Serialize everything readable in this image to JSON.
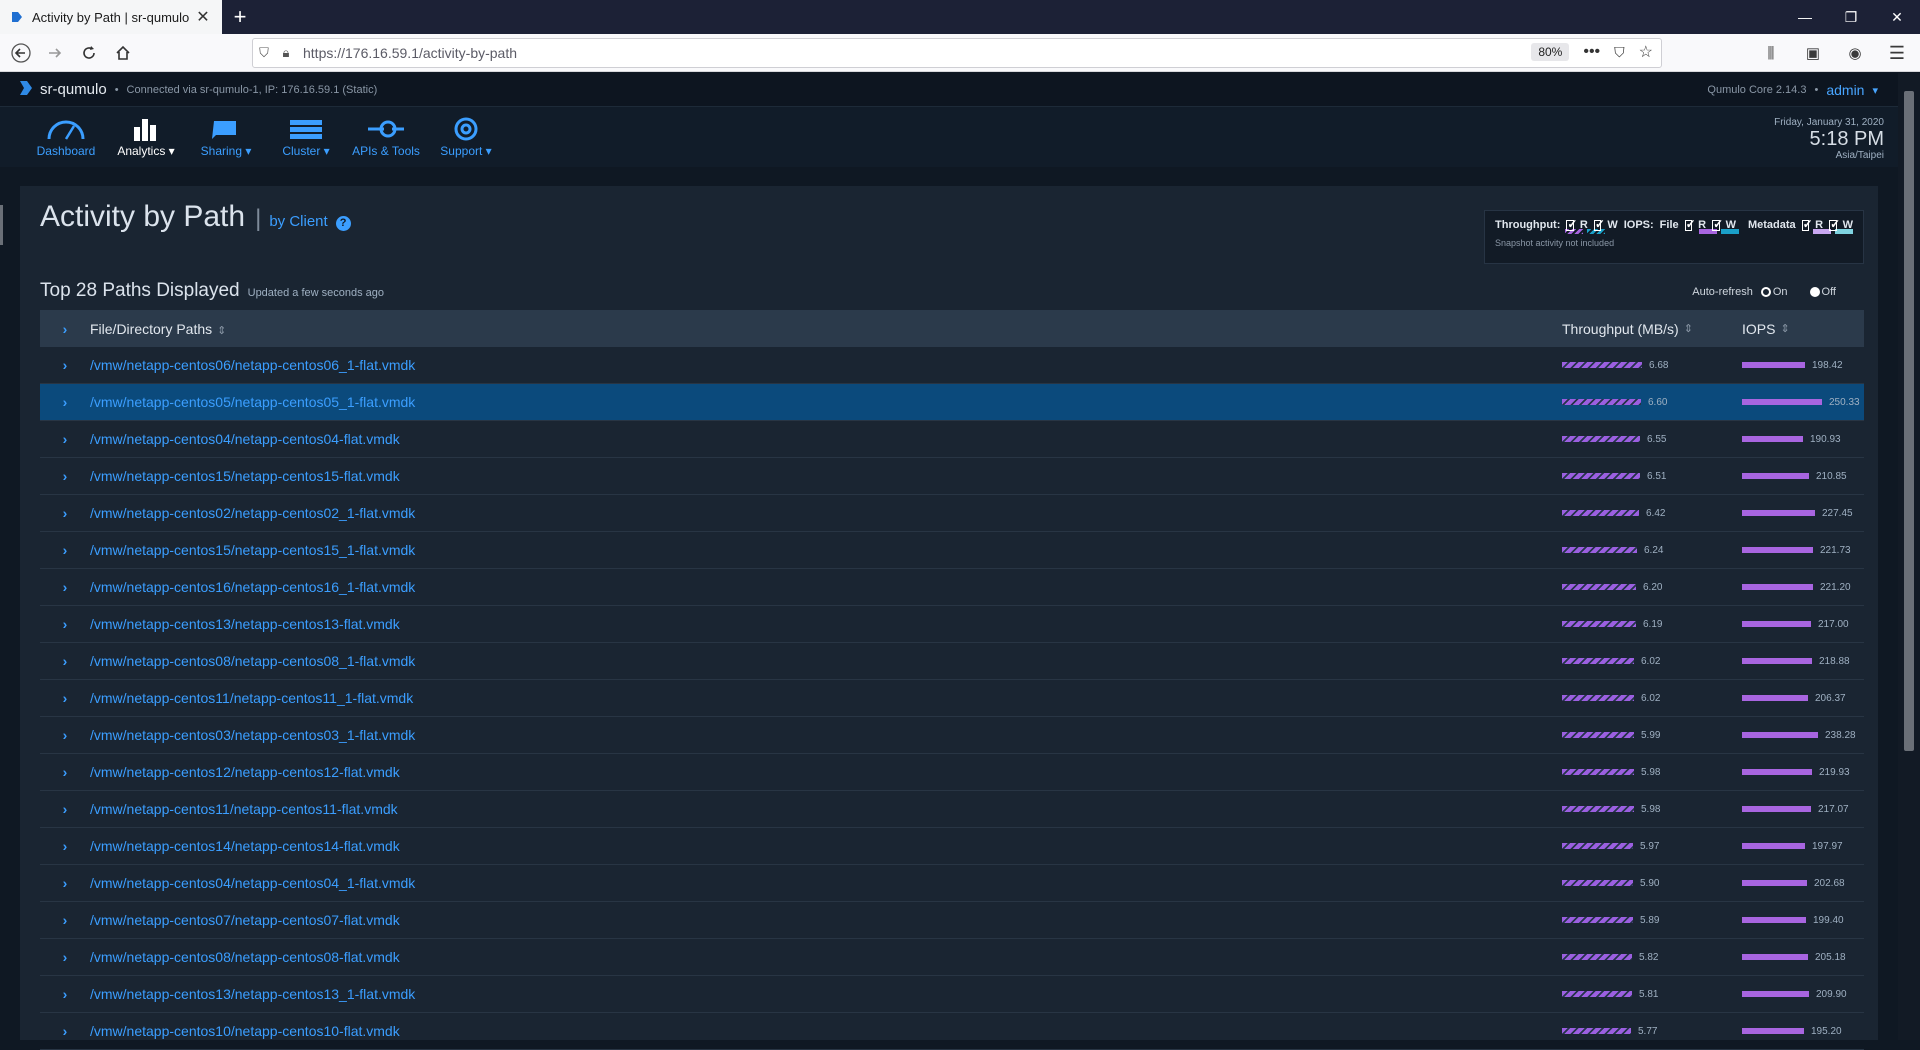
{
  "browser": {
    "tab_title": "Activity by Path | sr-qumulo",
    "url": "https://176.16.59.1/activity-by-path",
    "zoom": "80%"
  },
  "app": {
    "brand": "sr-qumulo",
    "connection": "Connected via sr-qumulo-1, IP: 176.16.59.1 (Static)",
    "version": "Qumulo Core 2.14.3",
    "user": "admin"
  },
  "nav": {
    "items": [
      {
        "label": "Dashboard",
        "icon": "dashboard-icon"
      },
      {
        "label": "Analytics ▾",
        "icon": "analytics-icon"
      },
      {
        "label": "Sharing ▾",
        "icon": "sharing-icon"
      },
      {
        "label": "Cluster ▾",
        "icon": "cluster-icon"
      },
      {
        "label": "APIs & Tools",
        "icon": "apis-icon"
      },
      {
        "label": "Support ▾",
        "icon": "support-icon"
      }
    ]
  },
  "clock": {
    "date": "Friday, January 31, 2020",
    "time": "5:18 PM",
    "tz": "Asia/Taipei"
  },
  "page": {
    "title": "Activity by Path",
    "by_client": "by Client",
    "subtitle": "Top 28 Paths Displayed",
    "updated": "Updated a few seconds ago",
    "auto_refresh": "Auto-refresh",
    "on": "On",
    "off": "Off"
  },
  "legend": {
    "throughput": "Throughput:",
    "iops": "IOPS:",
    "file": "File",
    "metadata": "Metadata",
    "r": "R",
    "w": "W",
    "note": "Snapshot activity not included",
    "colors": {
      "read": "#a865e0",
      "write": "#1aa0c8",
      "meta_read": "#c9a7f0",
      "meta_write": "#7fd3e0"
    }
  },
  "table": {
    "headers": {
      "path": "File/Directory Paths",
      "throughput": "Throughput (MB/s)",
      "iops": "IOPS"
    },
    "max_throughput": 6.68,
    "max_iops": 250.33,
    "rows": [
      {
        "path": "/vmw/netapp-centos06/netapp-centos06_1-flat.vmdk",
        "tp": "6.68",
        "iops": "198.42"
      },
      {
        "path": "/vmw/netapp-centos05/netapp-centos05_1-flat.vmdk",
        "tp": "6.60",
        "iops": "250.33",
        "selected": true
      },
      {
        "path": "/vmw/netapp-centos04/netapp-centos04-flat.vmdk",
        "tp": "6.55",
        "iops": "190.93"
      },
      {
        "path": "/vmw/netapp-centos15/netapp-centos15-flat.vmdk",
        "tp": "6.51",
        "iops": "210.85"
      },
      {
        "path": "/vmw/netapp-centos02/netapp-centos02_1-flat.vmdk",
        "tp": "6.42",
        "iops": "227.45"
      },
      {
        "path": "/vmw/netapp-centos15/netapp-centos15_1-flat.vmdk",
        "tp": "6.24",
        "iops": "221.73"
      },
      {
        "path": "/vmw/netapp-centos16/netapp-centos16_1-flat.vmdk",
        "tp": "6.20",
        "iops": "221.20"
      },
      {
        "path": "/vmw/netapp-centos13/netapp-centos13-flat.vmdk",
        "tp": "6.19",
        "iops": "217.00"
      },
      {
        "path": "/vmw/netapp-centos08/netapp-centos08_1-flat.vmdk",
        "tp": "6.02",
        "iops": "218.88"
      },
      {
        "path": "/vmw/netapp-centos11/netapp-centos11_1-flat.vmdk",
        "tp": "6.02",
        "iops": "206.37"
      },
      {
        "path": "/vmw/netapp-centos03/netapp-centos03_1-flat.vmdk",
        "tp": "5.99",
        "iops": "238.28"
      },
      {
        "path": "/vmw/netapp-centos12/netapp-centos12-flat.vmdk",
        "tp": "5.98",
        "iops": "219.93"
      },
      {
        "path": "/vmw/netapp-centos11/netapp-centos11-flat.vmdk",
        "tp": "5.98",
        "iops": "217.07"
      },
      {
        "path": "/vmw/netapp-centos14/netapp-centos14-flat.vmdk",
        "tp": "5.97",
        "iops": "197.97"
      },
      {
        "path": "/vmw/netapp-centos04/netapp-centos04_1-flat.vmdk",
        "tp": "5.90",
        "iops": "202.68"
      },
      {
        "path": "/vmw/netapp-centos07/netapp-centos07-flat.vmdk",
        "tp": "5.89",
        "iops": "199.40"
      },
      {
        "path": "/vmw/netapp-centos08/netapp-centos08-flat.vmdk",
        "tp": "5.82",
        "iops": "205.18"
      },
      {
        "path": "/vmw/netapp-centos13/netapp-centos13_1-flat.vmdk",
        "tp": "5.81",
        "iops": "209.90"
      },
      {
        "path": "/vmw/netapp-centos10/netapp-centos10-flat.vmdk",
        "tp": "5.77",
        "iops": "195.20"
      }
    ]
  }
}
